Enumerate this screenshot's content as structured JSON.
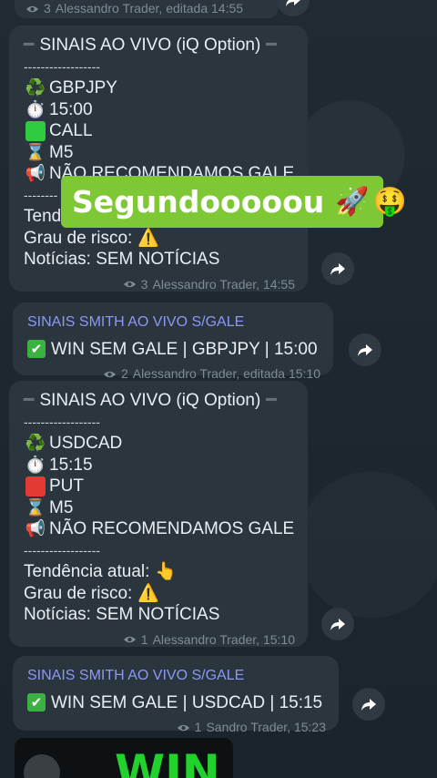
{
  "top_meta": {
    "views": "3",
    "author": "Alessandro Trader, editada 14:55"
  },
  "signal1": {
    "header": "SINAIS AO VIVO (iQ Option)",
    "divider": "------------------",
    "pair": "GBPJPY",
    "time": "15:00",
    "direction": "CALL",
    "timeframe": "M5",
    "gale": "NÃO RECOMENDAMOS GALE",
    "divider2": "--------",
    "trend_label": "Tend",
    "risk_label": "Grau de risco:",
    "news_label": "Notícias: SEM NOTÍCIAS",
    "views": "3",
    "author": "Alessandro Trader, 14:55"
  },
  "sticker": {
    "text": "Segundooooou",
    "rocket": "🚀",
    "money_face": "🤑"
  },
  "result1": {
    "channel": "SINAIS SMITH AO VIVO S/GALE",
    "text": "WIN SEM GALE |   GBPJPY | 15:00",
    "views": "2",
    "author": "Alessandro Trader, editada 15:10"
  },
  "signal2": {
    "header": "SINAIS AO VIVO (iQ Option)",
    "divider": "------------------",
    "pair": "USDCAD",
    "time": "15:15",
    "direction": "PUT",
    "timeframe": "M5",
    "gale": "NÃO RECOMENDAMOS GALE",
    "divider2": "------------------",
    "trend_label": "Tendência atual:",
    "risk_label": "Grau de risco:",
    "news_label": "Notícias: SEM NOTÍCIAS",
    "views": "1",
    "author": "Alessandro Trader, 15:10"
  },
  "result2": {
    "channel": "SINAIS SMITH AO VIVO S/GALE",
    "text": "WIN SEM GALE |   USDCAD | 15:15",
    "views": "1",
    "author": "Sandro Trader, 15:23"
  },
  "win_image": {
    "text": "WIN"
  },
  "icons": {
    "recycle": "♻️",
    "clock": "⏱️",
    "hourglass": "⌛",
    "megaphone": "📢",
    "warning": "⚠️",
    "point_up": "👆",
    "check": "✔",
    "share": "share-icon",
    "eye": "eye-icon"
  },
  "colors": {
    "bubble": "#2a353e",
    "channel": "#8d98f2",
    "sticker_bg": "#7ec836",
    "win_green": "#22d22c"
  }
}
